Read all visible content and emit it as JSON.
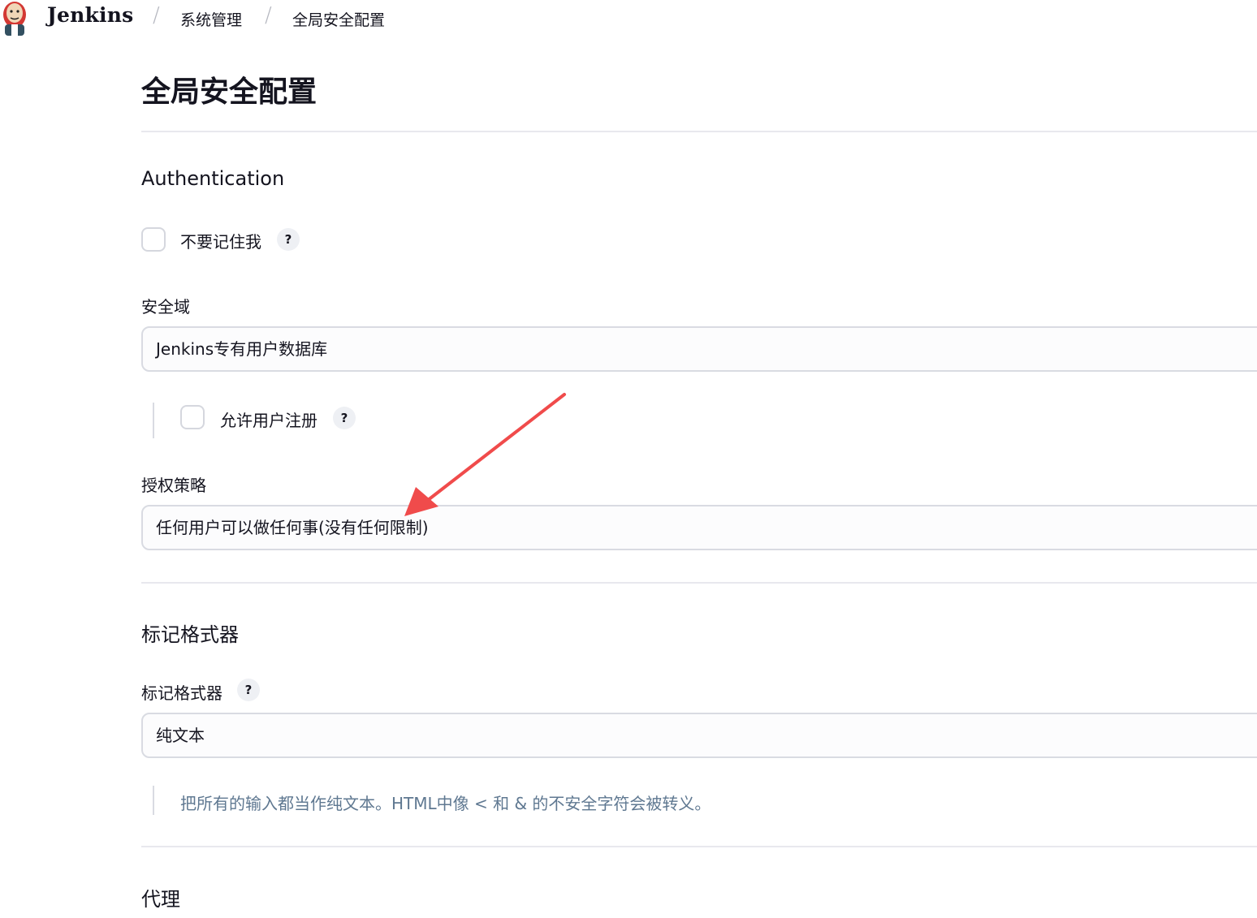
{
  "header": {
    "brand": "Jenkins",
    "breadcrumbs": [
      "系统管理",
      "全局安全配置"
    ],
    "separator": "/"
  },
  "page": {
    "title": "全局安全配置"
  },
  "authentication": {
    "section_title": "Authentication",
    "remember_me": {
      "label": "不要记住我",
      "checked": false,
      "help": "?"
    },
    "security_realm": {
      "label": "安全域",
      "selected": "Jenkins专有用户数据库",
      "allow_signup": {
        "label": "允许用户注册",
        "checked": false,
        "help": "?"
      }
    },
    "authorization": {
      "label": "授权策略",
      "selected": "任何用户可以做任何事(没有任何限制)"
    }
  },
  "markup_formatter": {
    "section_title": "标记格式器",
    "label": "标记格式器",
    "help": "?",
    "selected": "纯文本",
    "description": "把所有的输入都当作纯文本。HTML中像 < 和 & 的不安全字符会被转义。"
  },
  "proxy": {
    "section_title": "代理"
  },
  "colors": {
    "annotation_arrow": "#f04b4b",
    "description_text": "#5f7891",
    "border": "#d9dbe2"
  }
}
